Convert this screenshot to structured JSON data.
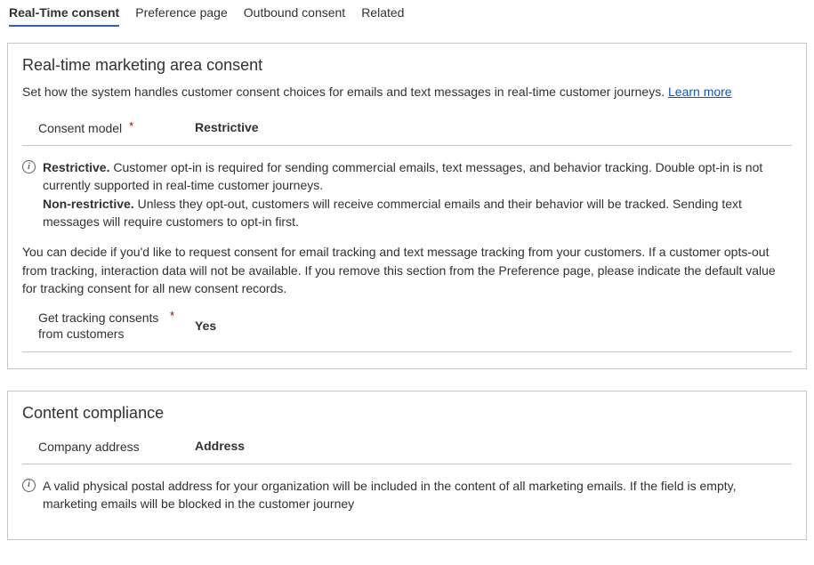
{
  "tabs": {
    "realtime": "Real-Time consent",
    "preference": "Preference page",
    "outbound": "Outbound consent",
    "related": "Related"
  },
  "section1": {
    "title": "Real-time marketing area consent",
    "desc_pre": "Set how the system handles customer consent choices for emails and text messages in real-time customer journeys. ",
    "learn_more": "Learn more",
    "consent_model": {
      "label": "Consent model",
      "value": "Restrictive"
    },
    "info": {
      "restrictive_label": "Restrictive.",
      "restrictive_text": " Customer opt-in is required for sending commercial emails, text messages, and behavior tracking. Double opt-in is not currently supported in real-time customer journeys.",
      "nonrestrictive_label": "Non-restrictive.",
      "nonrestrictive_text": " Unless they opt-out, customers will receive commercial emails and their behavior will be tracked. Sending text messages will require customers to opt-in first."
    },
    "sub_desc": "You can decide if you'd like to request consent for email tracking and text message tracking from your customers. If a customer opts-out from tracking, interaction data will not be available. If you remove this section from the Preference page, please indicate the default value for tracking consent for all new consent records.",
    "tracking": {
      "label": "Get tracking consents from customers",
      "value": "Yes"
    }
  },
  "section2": {
    "title": "Content compliance",
    "company_address": {
      "label": "Company address",
      "value": "Address"
    },
    "info": "A valid physical postal address for your organization will be included in the content of all marketing emails. If the field is empty, marketing emails will be blocked in the customer journey"
  }
}
